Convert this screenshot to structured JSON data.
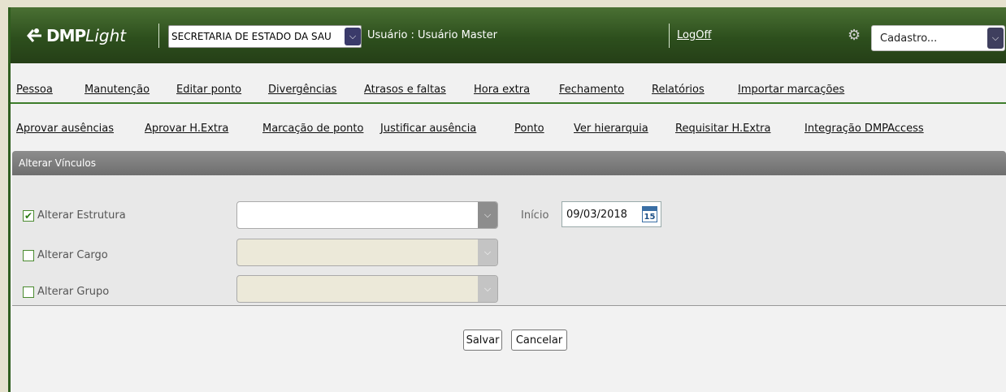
{
  "header": {
    "logo_bold": "DMP",
    "logo_italic": "Light",
    "org_select_value": "SECRETARIA DE ESTADO DA SAU",
    "user_label": "Usuário : Usuário Master",
    "logoff_label": "LogOff",
    "cadastro_select_value": "Cadastro..."
  },
  "menu_primary": [
    "Pessoa",
    "Manutenção",
    "Editar ponto",
    "Divergências",
    "Atrasos e faltas",
    "Hora extra",
    "Fechamento",
    "Relatórios",
    "Importar marcações"
  ],
  "menu_secondary": [
    "Aprovar ausências",
    "Aprovar H.Extra",
    "Marcação de ponto",
    "Justificar ausência",
    "Ponto",
    "Ver hierarquia",
    "Requisitar H.Extra",
    "Integração DMPAccess"
  ],
  "panel": {
    "title": "Alterar Vínculos",
    "rows": [
      {
        "label": "Alterar Estrutura",
        "checked": true,
        "enabled": true
      },
      {
        "label": "Alterar Cargo",
        "checked": false,
        "enabled": false
      },
      {
        "label": "Alterar Grupo",
        "checked": false,
        "enabled": false
      }
    ],
    "inicio_label": "Início",
    "inicio_value": "09/03/2018",
    "calendar_day": "15"
  },
  "actions": {
    "save_label": "Salvar",
    "cancel_label": "Cancelar"
  },
  "colors": {
    "header_green": "#2d4f1d",
    "menu_divider": "#3e7d2b",
    "panel_title": "#7a7a7a"
  }
}
